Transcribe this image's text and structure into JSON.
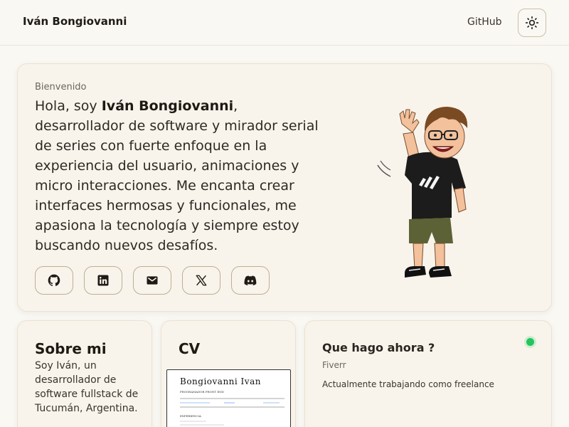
{
  "header": {
    "brand": "Iván Bongiovanni",
    "nav_github": "GitHub",
    "theme_toggle_icon": "sun-icon"
  },
  "hero": {
    "kicker": "Bienvenido",
    "intro_before": "Hola, soy ",
    "intro_name": "Iván Bongiovanni",
    "intro_after": ", desarrollador de software y mirador serial de series con fuerte enfoque en la experiencia del usuario, animaciones y micro interacciones. Me encanta crear interfaces hermosas y funcionales, me apasiona la tecnología y siempre estoy buscando nuevos desafíos.",
    "socials": [
      "github-icon",
      "linkedin-icon",
      "mail-icon",
      "x-icon",
      "discord-icon"
    ]
  },
  "about": {
    "title": "Sobre mi",
    "text": "Soy Iván, un desarrollador de software fullstack de Tucumán, Argentina."
  },
  "cv": {
    "title": "CV",
    "doc_name": "Bongiovanni Ivan",
    "doc_role": "PROGRAMADOR FRONT END",
    "doc_section": "EXPERIENCIA"
  },
  "now": {
    "title": "Que hago ahora ?",
    "subtitle": "Fiverr",
    "description": "Actualmente trabajando como freelance",
    "status_color": "#22c55e"
  },
  "colors": {
    "background": "#faf8f3",
    "card": "#f8f4ec",
    "border": "#bfae92",
    "text": "#2a251f"
  }
}
